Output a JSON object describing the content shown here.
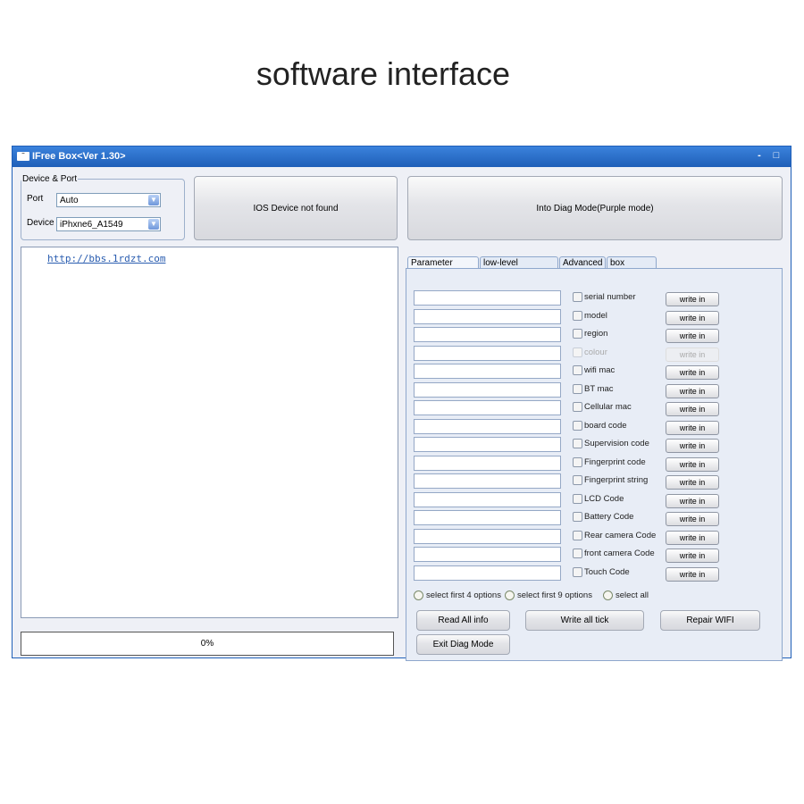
{
  "caption": "software interface",
  "window": {
    "title": "IFree Box<Ver 1.30>",
    "icon": "app-logo-icon",
    "minimize": "-",
    "maximize": "□"
  },
  "device_port": {
    "legend": "Device & Port",
    "port_label": "Port",
    "port_value": "Auto",
    "device_label": "Device",
    "device_value": "iPhxne6_A1549"
  },
  "status_button": "IOS Device not found",
  "diag_button": "Into Diag Mode(Purple mode)",
  "log": {
    "link": "http://bbs.1rdzt.com"
  },
  "progress": {
    "text": "0%",
    "value": 0
  },
  "tabs": [
    "Parameter update",
    "low-level Parameter",
    "Advanced",
    "box firmware"
  ],
  "active_tab": 0,
  "params": [
    {
      "label": "serial number",
      "enabled": true
    },
    {
      "label": "model",
      "enabled": true
    },
    {
      "label": "region",
      "enabled": true
    },
    {
      "label": "colour",
      "enabled": false
    },
    {
      "label": "wifi mac",
      "enabled": true
    },
    {
      "label": "BT mac",
      "enabled": true
    },
    {
      "label": "Cellular mac",
      "enabled": true
    },
    {
      "label": "board code",
      "enabled": true
    },
    {
      "label": "Supervision code",
      "enabled": true
    },
    {
      "label": "Fingerprint code",
      "enabled": true
    },
    {
      "label": "Fingerprint string",
      "enabled": true
    },
    {
      "label": "LCD Code",
      "enabled": true
    },
    {
      "label": "Battery Code",
      "enabled": true
    },
    {
      "label": "Rear camera Code",
      "enabled": true
    },
    {
      "label": "front camera Code",
      "enabled": true
    },
    {
      "label": "Touch Code",
      "enabled": true
    }
  ],
  "write_label": "write in",
  "radios": [
    "select first 4 options",
    "select first 9 options",
    "select all"
  ],
  "buttons": {
    "read_all": "Read All info",
    "write_all": "Write all tick",
    "repair_wifi": "Repair WIFI",
    "exit_diag": "Exit Diag Mode"
  }
}
